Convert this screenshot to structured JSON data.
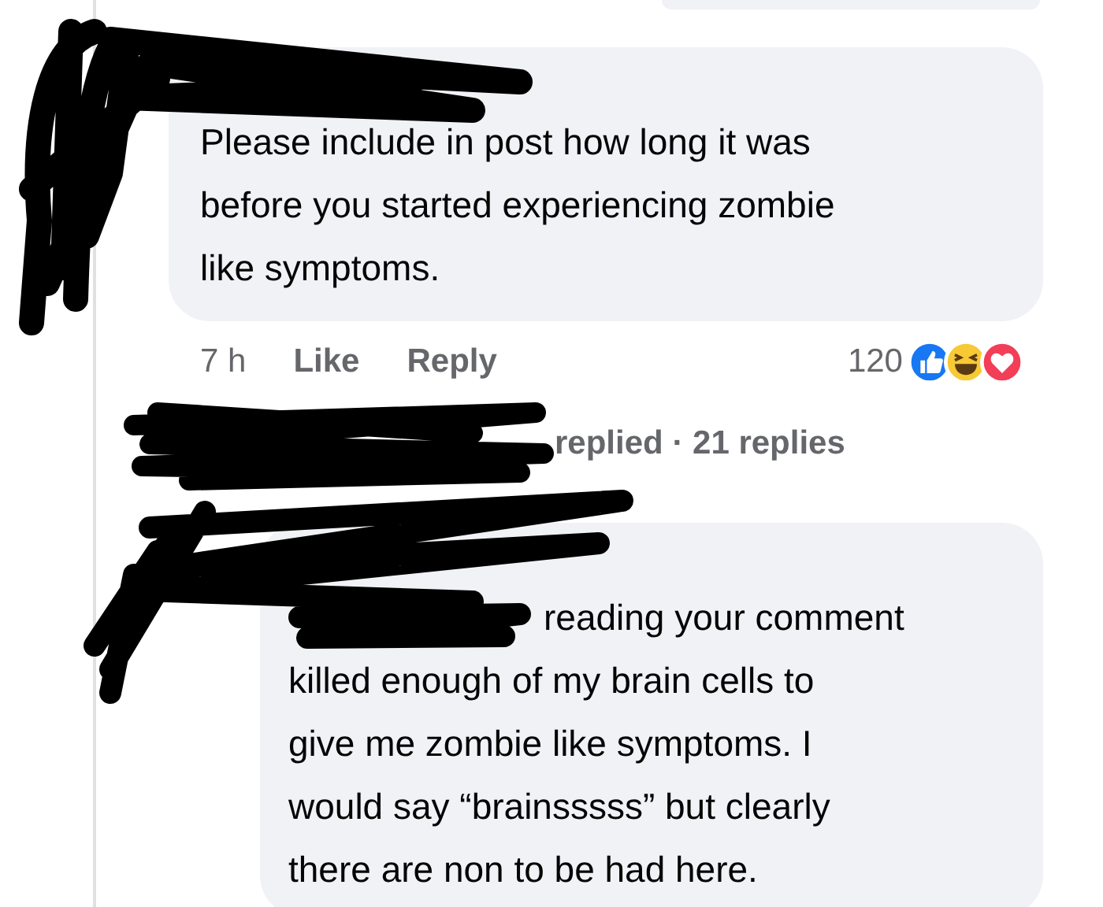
{
  "comment": {
    "lines": [
      "Please include in post how long it was",
      "before you started experiencing zombie",
      "like symptoms."
    ],
    "time": "7 h",
    "actions": [
      "Like",
      "Reply"
    ],
    "reaction_count": "120",
    "reactions": [
      {
        "kind": "like"
      },
      {
        "kind": "haha"
      },
      {
        "kind": "love"
      }
    ]
  },
  "replies_link": "replied · 21 replies",
  "reply": {
    "lines": [
      "reading your comment",
      "killed enough of my brain cells to",
      "give me zombie like symptoms. I",
      "would say “brainsssss” but clearly",
      "there are non to be had here."
    ]
  }
}
